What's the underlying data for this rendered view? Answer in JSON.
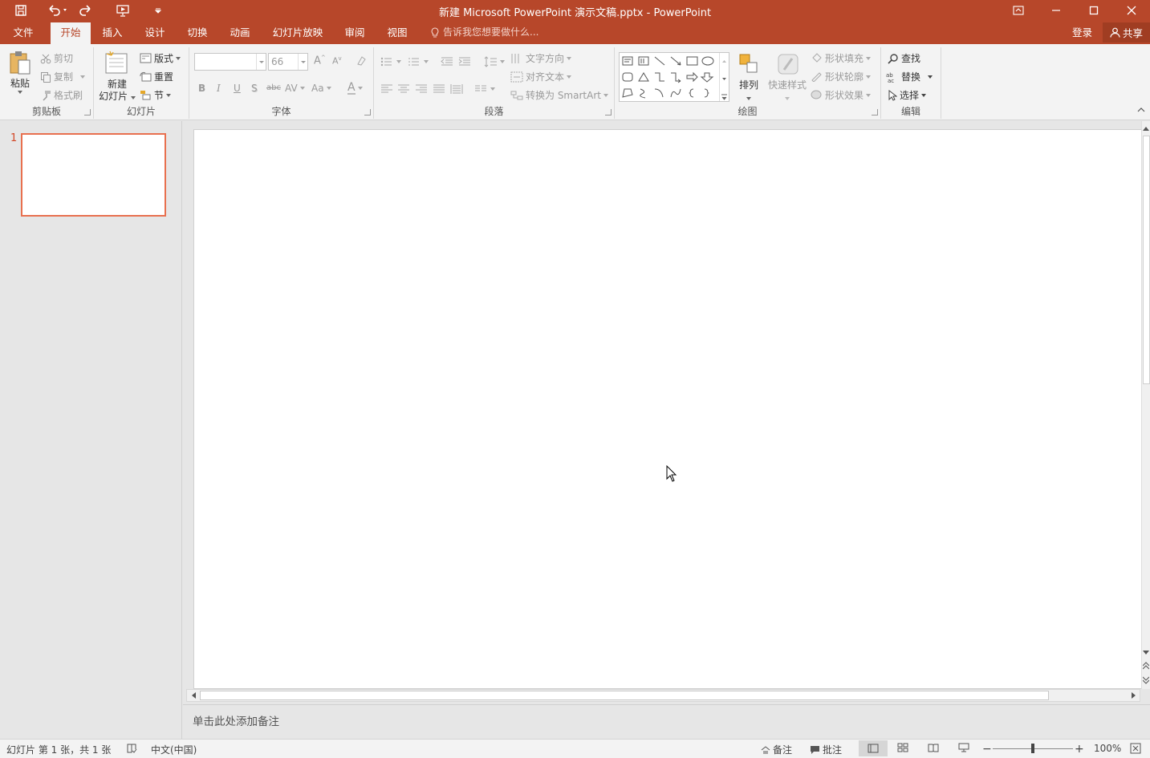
{
  "window": {
    "title": "新建 Microsoft PowerPoint 演示文稿.pptx - PowerPoint"
  },
  "tabs": [
    {
      "label": "文件",
      "active": false
    },
    {
      "label": "开始",
      "active": true
    },
    {
      "label": "插入",
      "active": false
    },
    {
      "label": "设计",
      "active": false
    },
    {
      "label": "切换",
      "active": false
    },
    {
      "label": "动画",
      "active": false
    },
    {
      "label": "幻灯片放映",
      "active": false
    },
    {
      "label": "审阅",
      "active": false
    },
    {
      "label": "视图",
      "active": false
    }
  ],
  "tellme": "告诉我您想要做什么...",
  "account": {
    "signin": "登录",
    "share": "共享"
  },
  "ribbon": {
    "clipboard": {
      "label": "剪贴板",
      "paste": "粘贴",
      "cut": "剪切",
      "copy": "复制",
      "format_painter": "格式刷"
    },
    "slides": {
      "label": "幻灯片",
      "new_slide_line1": "新建",
      "new_slide_line2": "幻灯片",
      "layout": "版式",
      "reset": "重置",
      "section": "节"
    },
    "font": {
      "label": "字体",
      "font_name": "",
      "font_size": "66"
    },
    "paragraph": {
      "label": "段落",
      "text_direction": "文字方向",
      "align_text": "对齐文本",
      "smartart": "转换为 SmartArt"
    },
    "drawing": {
      "label": "绘图",
      "arrange": "排列",
      "quick_styles": "快速样式",
      "shape_fill": "形状填充",
      "shape_outline": "形状轮廓",
      "shape_effects": "形状效果"
    },
    "editing": {
      "label": "编辑",
      "find": "查找",
      "replace": "替换",
      "select": "选择"
    }
  },
  "thumbnails": [
    {
      "number": "1"
    }
  ],
  "notes_placeholder": "单击此处添加备注",
  "status": {
    "slide_info": "幻灯片 第 1 张，共 1 张",
    "language": "中文(中国)",
    "notes": "备注",
    "comments": "批注",
    "zoom": "100%",
    "zoom_level": 0.5
  },
  "colors": {
    "accent": "#b7472a",
    "thumb_border": "#e8704f"
  }
}
